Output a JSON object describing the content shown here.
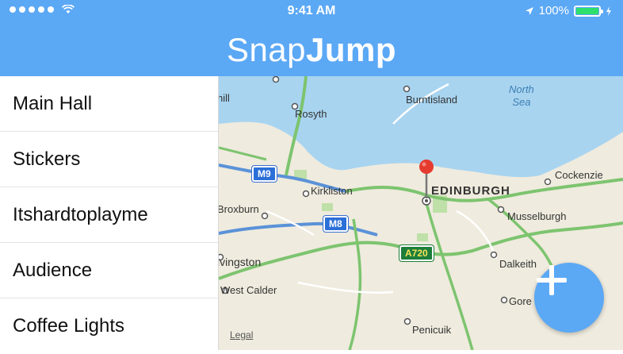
{
  "status": {
    "time": "9:41 AM",
    "battery": "100%",
    "signal_icon": "signal-dots",
    "wifi_icon": "wifi-icon",
    "location_icon": "location-arrow-icon",
    "battery_fraction": 1.0
  },
  "header": {
    "title_light": "Snap",
    "title_bold": "Jump",
    "background": "#5BA8F5"
  },
  "sidebar": {
    "items": [
      {
        "label": "Main Hall"
      },
      {
        "label": "Stickers"
      },
      {
        "label": "Itshardtoplayme"
      },
      {
        "label": "Audience"
      },
      {
        "label": "Coffee Lights"
      }
    ]
  },
  "map": {
    "labels": {
      "burntisland": "Burntisland",
      "rosyth": "Rosyth",
      "north_sea_1": "North",
      "north_sea_2": "Sea",
      "kirkliston": "Kirkliston",
      "edinburgh": "EDINBURGH",
      "cockenzie": "Cockenzie",
      "broxburn": "Broxburn",
      "musselburgh": "Musselburgh",
      "livingston": "ivingston",
      "dalkeith": "Dalkeith",
      "west_calder": "West Calder",
      "gore": "Gore",
      "penicuik": "Penicuik",
      "hill": "hill"
    },
    "roads": {
      "m9": "M9",
      "m8": "M8",
      "a720": "A720"
    },
    "legal": "Legal",
    "colors": {
      "land": "#EFEBDE",
      "water": "#A8D4F0",
      "motorway": "#5A92D8",
      "aroad": "#7DC46F",
      "park": "#BFE0A8",
      "pin": "#E53B2F"
    }
  },
  "fab": {
    "icon": "plus-icon"
  }
}
